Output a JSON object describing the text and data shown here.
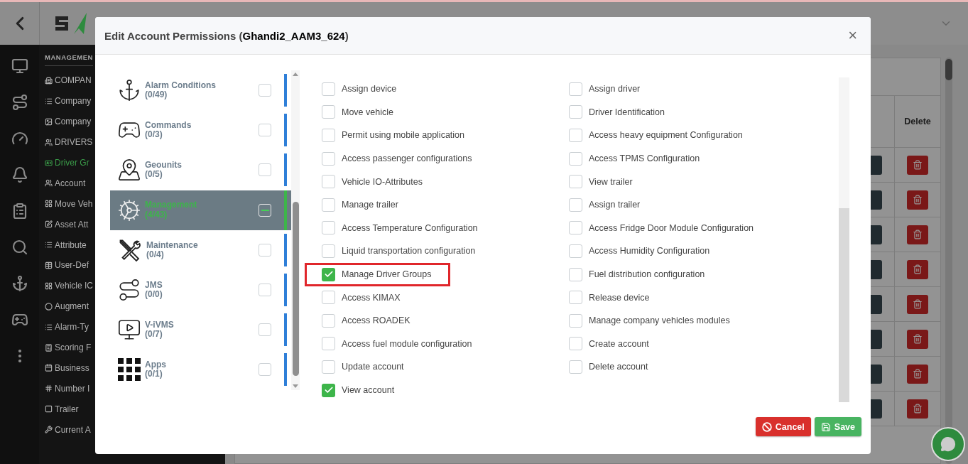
{
  "menu": {
    "heading": "MANAGEMEN",
    "items": [
      {
        "label": "COMPAN",
        "kind": "building",
        "selected": false
      },
      {
        "label": "Company",
        "kind": "list",
        "selected": false
      },
      {
        "label": "Company",
        "kind": "image",
        "selected": false
      },
      {
        "label": "DRIVERS",
        "kind": "users",
        "selected": false
      },
      {
        "label": "Driver Gr",
        "kind": "id",
        "selected": true
      },
      {
        "label": "Account",
        "kind": "users",
        "selected": false
      },
      {
        "label": "Move Veh",
        "kind": "grid",
        "selected": false
      },
      {
        "label": "Asset Att",
        "kind": "edit",
        "selected": false
      },
      {
        "label": "Attribute",
        "kind": "list",
        "selected": false
      },
      {
        "label": "User-Def",
        "kind": "table",
        "selected": false
      },
      {
        "label": "Vehicle IC",
        "kind": "grid",
        "selected": false
      },
      {
        "label": "Augment",
        "kind": "circle",
        "selected": false
      },
      {
        "label": "Alarm-Ty",
        "kind": "list",
        "selected": false
      },
      {
        "label": "Scoring F",
        "kind": "calc",
        "selected": false
      },
      {
        "label": "Business",
        "kind": "calendar",
        "selected": false
      },
      {
        "label": "Number I",
        "kind": "hash",
        "selected": false
      },
      {
        "label": "Trailer",
        "kind": "square",
        "selected": false
      },
      {
        "label": "Current A",
        "kind": "wrench",
        "selected": false
      }
    ]
  },
  "table": {
    "columns": [
      "Delete"
    ]
  },
  "dialog": {
    "title": "Edit Account Permissions (**Ghandi2_AAM3_624**)",
    "close": "×",
    "categories": [
      {
        "name": "Alarm Conditions",
        "count": "(0/49)",
        "kind": "anchor",
        "selected": false,
        "partial": false
      },
      {
        "name": "Commands",
        "count": "(0/3)",
        "kind": "gamepad",
        "selected": false,
        "partial": false
      },
      {
        "name": "Geounits",
        "count": "(0/5)",
        "kind": "map",
        "selected": false,
        "partial": false
      },
      {
        "name": "Management",
        "count": "(4/43)",
        "kind": "gears",
        "selected": true,
        "partial": true
      },
      {
        "name": "Maintenance",
        "count": "(0/4)",
        "kind": "tools",
        "selected": false,
        "partial": false
      },
      {
        "name": "JMS",
        "count": "(0/0)",
        "kind": "route",
        "selected": false,
        "partial": false
      },
      {
        "name": "V-iVMS",
        "count": "(0/7)",
        "kind": "monitor",
        "selected": false,
        "partial": false
      },
      {
        "name": "Apps",
        "count": "(0/1)",
        "kind": "grid",
        "selected": false,
        "partial": false
      }
    ],
    "permissions": [
      {
        "label": "Assign device",
        "checked": false,
        "highlighted": false
      },
      {
        "label": "Assign driver",
        "checked": false,
        "highlighted": false
      },
      {
        "label": "Move vehicle",
        "checked": false,
        "highlighted": false
      },
      {
        "label": "Driver Identification",
        "checked": false,
        "highlighted": false
      },
      {
        "label": "Permit using mobile application",
        "checked": false,
        "highlighted": false
      },
      {
        "label": "Access heavy equipment Configuration",
        "checked": false,
        "highlighted": false
      },
      {
        "label": "Access passenger configurations",
        "checked": false,
        "highlighted": false
      },
      {
        "label": "Access TPMS Configuration",
        "checked": false,
        "highlighted": false
      },
      {
        "label": "Vehicle IO-Attributes",
        "checked": false,
        "highlighted": false
      },
      {
        "label": "View trailer",
        "checked": false,
        "highlighted": false
      },
      {
        "label": "Manage trailer",
        "checked": false,
        "highlighted": false
      },
      {
        "label": "Assign trailer",
        "checked": false,
        "highlighted": false
      },
      {
        "label": "Access Temperature Configuration",
        "checked": false,
        "highlighted": false
      },
      {
        "label": "Access Fridge Door Module Configuration",
        "checked": false,
        "highlighted": false
      },
      {
        "label": "Liquid transportation configuration",
        "checked": false,
        "highlighted": false
      },
      {
        "label": "Access Humidity Configuration",
        "checked": false,
        "highlighted": false
      },
      {
        "label": "Manage Driver Groups",
        "checked": true,
        "highlighted": true
      },
      {
        "label": "Fuel distribution configuration",
        "checked": false,
        "highlighted": false
      },
      {
        "label": "Access KIMAX",
        "checked": false,
        "highlighted": false
      },
      {
        "label": "Release device",
        "checked": false,
        "highlighted": false
      },
      {
        "label": "Access ROADEK",
        "checked": false,
        "highlighted": false
      },
      {
        "label": "Manage company vehicles modules",
        "checked": false,
        "highlighted": false
      },
      {
        "label": "Access fuel module configuration",
        "checked": false,
        "highlighted": false
      },
      {
        "label": "Create account",
        "checked": false,
        "highlighted": false
      },
      {
        "label": "Update account",
        "checked": false,
        "highlighted": false
      },
      {
        "label": "Delete account",
        "checked": false,
        "highlighted": false
      },
      {
        "label": "View account",
        "checked": true,
        "highlighted": false
      }
    ],
    "buttons": [
      {
        "label": "Cancel",
        "kind": "cancel"
      },
      {
        "label": "Save",
        "kind": "save"
      }
    ]
  }
}
